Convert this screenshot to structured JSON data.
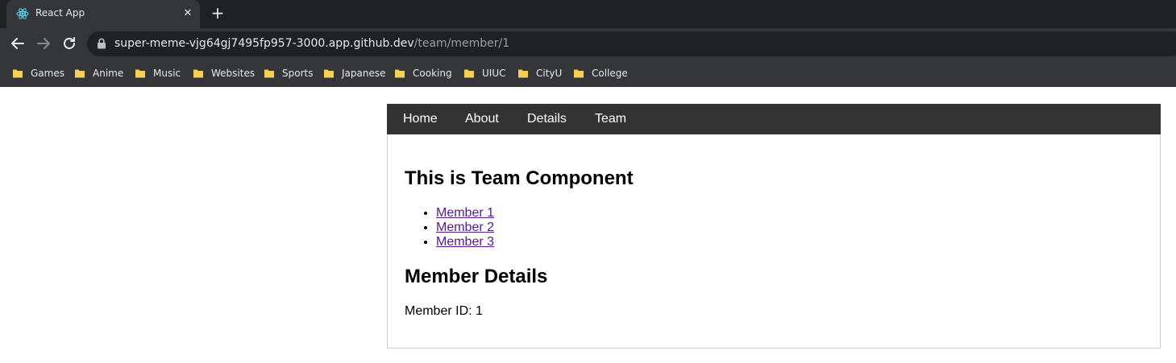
{
  "browser": {
    "tab_title": "React App",
    "tab_close": "✕",
    "new_tab": "+",
    "url_host": "super-meme-vjg64gj7495fp957-3000.app.github.dev",
    "url_path": "/team/member/1",
    "bookmarks": [
      "Games",
      "Anime",
      "Music",
      "Websites",
      "Sports",
      "Japanese",
      "Cooking",
      "UIUC",
      "CityU",
      "College"
    ],
    "colors": {
      "tabstrip": "#202124",
      "toolbar": "#35363a",
      "folder": "#f6cf57"
    }
  },
  "nav": {
    "home": "Home",
    "about": "About",
    "details": "Details",
    "team": "Team"
  },
  "team": {
    "heading": "This is Team Component",
    "members": [
      "Member 1",
      "Member 2",
      "Member 3"
    ]
  },
  "details": {
    "heading": "Member Details",
    "member_id_label": "Member ID: 1"
  }
}
